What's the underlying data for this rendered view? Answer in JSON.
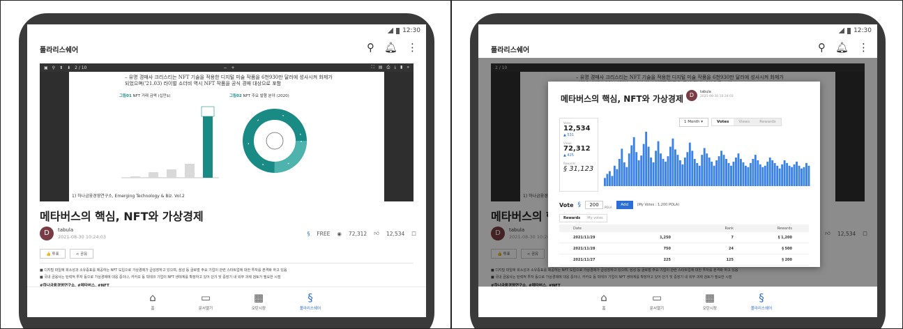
{
  "status": {
    "time": "12:30"
  },
  "app": {
    "title": "폴라리스쉐어"
  },
  "doc": {
    "title": "메타버스의 핵심, NFT와 가상경제",
    "author": "tabula",
    "date": "2021-08-30 10:24:03",
    "free_label": "FREE",
    "views": "72,312",
    "likes": "12,534",
    "like_btn": "👍 투표",
    "share_btn": "< 공유",
    "summary": [
      "■ 디지털 파일에 희소성과 소유증표를 제공하는 NFT 도입으로 가상경제가 급성장하고 있으며, 삼성 등 글로벌 주요 기업이 관련 스타트업에 대한 투자를 본격화 하고 있음",
      "■ 국내 금융사는 탄력적 투자 등으로 가상경제에 대응 중이나, 카카오 등 빅테크 기업이 NFT 생태계를 확장하고 있어 단기 및 중장기 내 외부 과제 검토가 필요한 시점"
    ],
    "tags": "#하나금융경영연구소, #메타버스, #NFT"
  },
  "pdf": {
    "page": "2 / 10",
    "text": "– 유명 경매사 크리스티는 NFT 기술을 적용한 디지털 미술 작품을 6천930만 달러에 성사시켜 화제가 되었으며('21.03) 라이벌 소더비 역시 NFT 작품을 공식 경매 대상으로 포함",
    "fig1_label": "그림01",
    "fig1_title": "NFT 거래 금액 (십만$)",
    "fig2_label": "그림02",
    "fig2_title": "NFT 주요 발행 분야 (2020)",
    "footer": "1) 하나금융경영연구소, Emerging Technology & Biz. Vol.2"
  },
  "nav": {
    "items": [
      {
        "label": "홈"
      },
      {
        "label": "문서열기"
      },
      {
        "label": "오탄시장"
      },
      {
        "label": "폴라리스쉐어"
      }
    ]
  },
  "modal": {
    "title": "메타버스의 핵심, NFT와 가상경제",
    "author": "tabula",
    "date": "2021-08-30 10:24:03",
    "period": "1 Month",
    "tabs": [
      "Votes",
      "Views",
      "Rewards"
    ],
    "stats": {
      "votes_label": "Votes",
      "votes": "12,534",
      "votes_delta": "▲ 531",
      "views_label": "Views",
      "views": "72,312",
      "views_delta": "▲ 425",
      "rewards_label": "Rewards",
      "rewards": "31,123"
    },
    "vote": {
      "label": "Vote",
      "amount": "200",
      "unit": "POLA",
      "add": "Add",
      "my_votes": "(My Votes : 1,200 POLA)"
    },
    "reward_tabs": [
      "Rewards",
      "My votes"
    ],
    "table": {
      "headers": [
        "Date",
        "",
        "Rank",
        "Rewards"
      ],
      "rows": [
        [
          "2021/11/29",
          "1,250",
          "7",
          "1,200"
        ],
        [
          "2021/11/28",
          "750",
          "24",
          "500"
        ],
        [
          "2021/11/27",
          "225",
          "125",
          "200"
        ]
      ]
    }
  },
  "chart_data": {
    "type": "bar",
    "title": "",
    "series": [
      {
        "values": [
          12,
          18,
          22,
          15,
          30,
          25,
          40,
          55,
          35,
          28,
          48,
          60,
          72,
          50,
          38,
          45,
          62,
          80,
          58,
          42,
          35,
          52,
          66,
          48,
          40,
          36,
          44,
          58,
          70,
          54,
          46,
          38,
          32,
          42,
          50,
          64,
          52,
          40,
          34,
          30,
          46,
          56,
          48,
          42,
          36,
          30,
          38,
          44,
          52,
          46,
          40,
          34,
          30,
          36,
          42,
          48,
          40,
          35,
          30,
          28,
          34,
          40,
          46,
          38,
          32,
          28,
          30,
          36,
          42,
          38,
          34,
          30,
          26,
          32,
          38,
          34,
          30,
          28,
          32,
          36,
          30,
          26,
          28,
          34,
          30
        ]
      }
    ],
    "color": "#3b82e6"
  },
  "colors": {
    "accent": "#2b6fd6",
    "avatar": "#7a3c44",
    "teal": "#1a8a85"
  }
}
